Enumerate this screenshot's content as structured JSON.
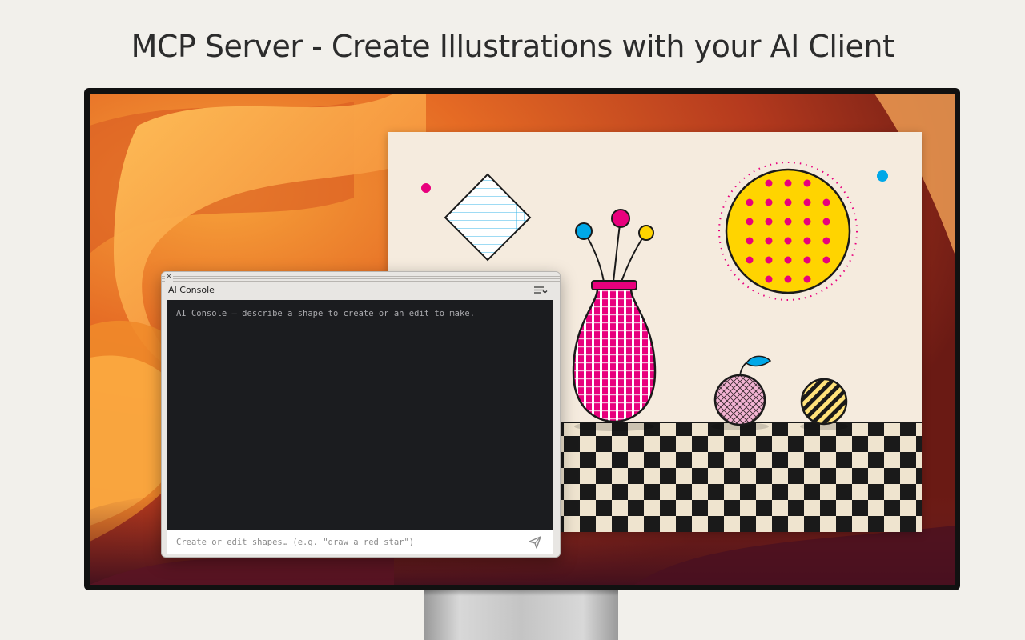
{
  "page": {
    "headline": "MCP Server - Create Illustrations with your AI Client"
  },
  "console": {
    "title": "AI Console",
    "close_glyph": "×",
    "message": "AI Console — describe a shape to create or an edit to make.",
    "input_placeholder": "Create or edit shapes… (e.g. \"draw a red star\")",
    "icons": {
      "close": "close-icon",
      "menu": "panel-menu-icon",
      "send": "send-icon"
    }
  },
  "colors": {
    "page_background": "#f2f0eb",
    "canvas_background": "#f5ebde",
    "magenta": "#e8007d",
    "cyan": "#00a8e8",
    "yellow": "#ffd400",
    "pink": "#f3b3d3",
    "checker_dark": "#1a1a1a",
    "checker_light": "#efe4cf",
    "console_background": "#1b1c1f"
  }
}
